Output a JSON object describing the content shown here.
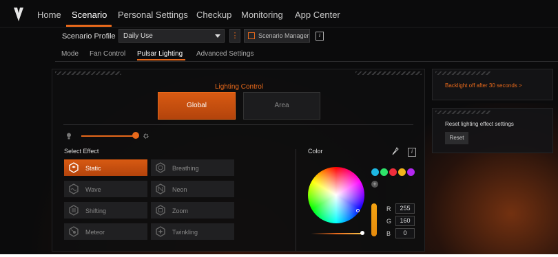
{
  "nav": {
    "items": [
      "Home",
      "Scenario",
      "Personal Settings",
      "Checkup",
      "Monitoring",
      "App Center"
    ],
    "active": "Scenario"
  },
  "profile": {
    "label": "Scenario Profile",
    "value": "Daily Use",
    "kebab": "⋮",
    "manager_label": "Scenario Manager",
    "info": "i"
  },
  "subtabs": {
    "items": [
      "Mode",
      "Fan Control",
      "Pulsar Lighting",
      "Advanced Settings"
    ],
    "active": "Pulsar Lighting"
  },
  "lighting": {
    "title": "Lighting Control",
    "tab_global": "Global",
    "tab_area": "Area",
    "brightness": 1.0,
    "select_effect_label": "Select Effect",
    "effects": [
      "Static",
      "Breathing",
      "Wave",
      "Neon",
      "Shifting",
      "Zoom",
      "Meteor",
      "Twinkling"
    ],
    "active_effect": "Static"
  },
  "color": {
    "label": "Color",
    "info": "i",
    "add": "+",
    "swatches": [
      "#1db7e3",
      "#2ee36a",
      "#ef2d3c",
      "#f1b41b",
      "#b327f0"
    ],
    "r_label": "R",
    "r": "255",
    "g_label": "G",
    "g": "160",
    "b_label": "B",
    "b": "0"
  },
  "cards": {
    "backlight_link": "Backlight off after 30 seconds >",
    "reset_text": "Reset lighting effect settings",
    "reset_button": "Reset"
  },
  "colors": {
    "accent": "#e8691b",
    "background": "#0b0b0c"
  }
}
